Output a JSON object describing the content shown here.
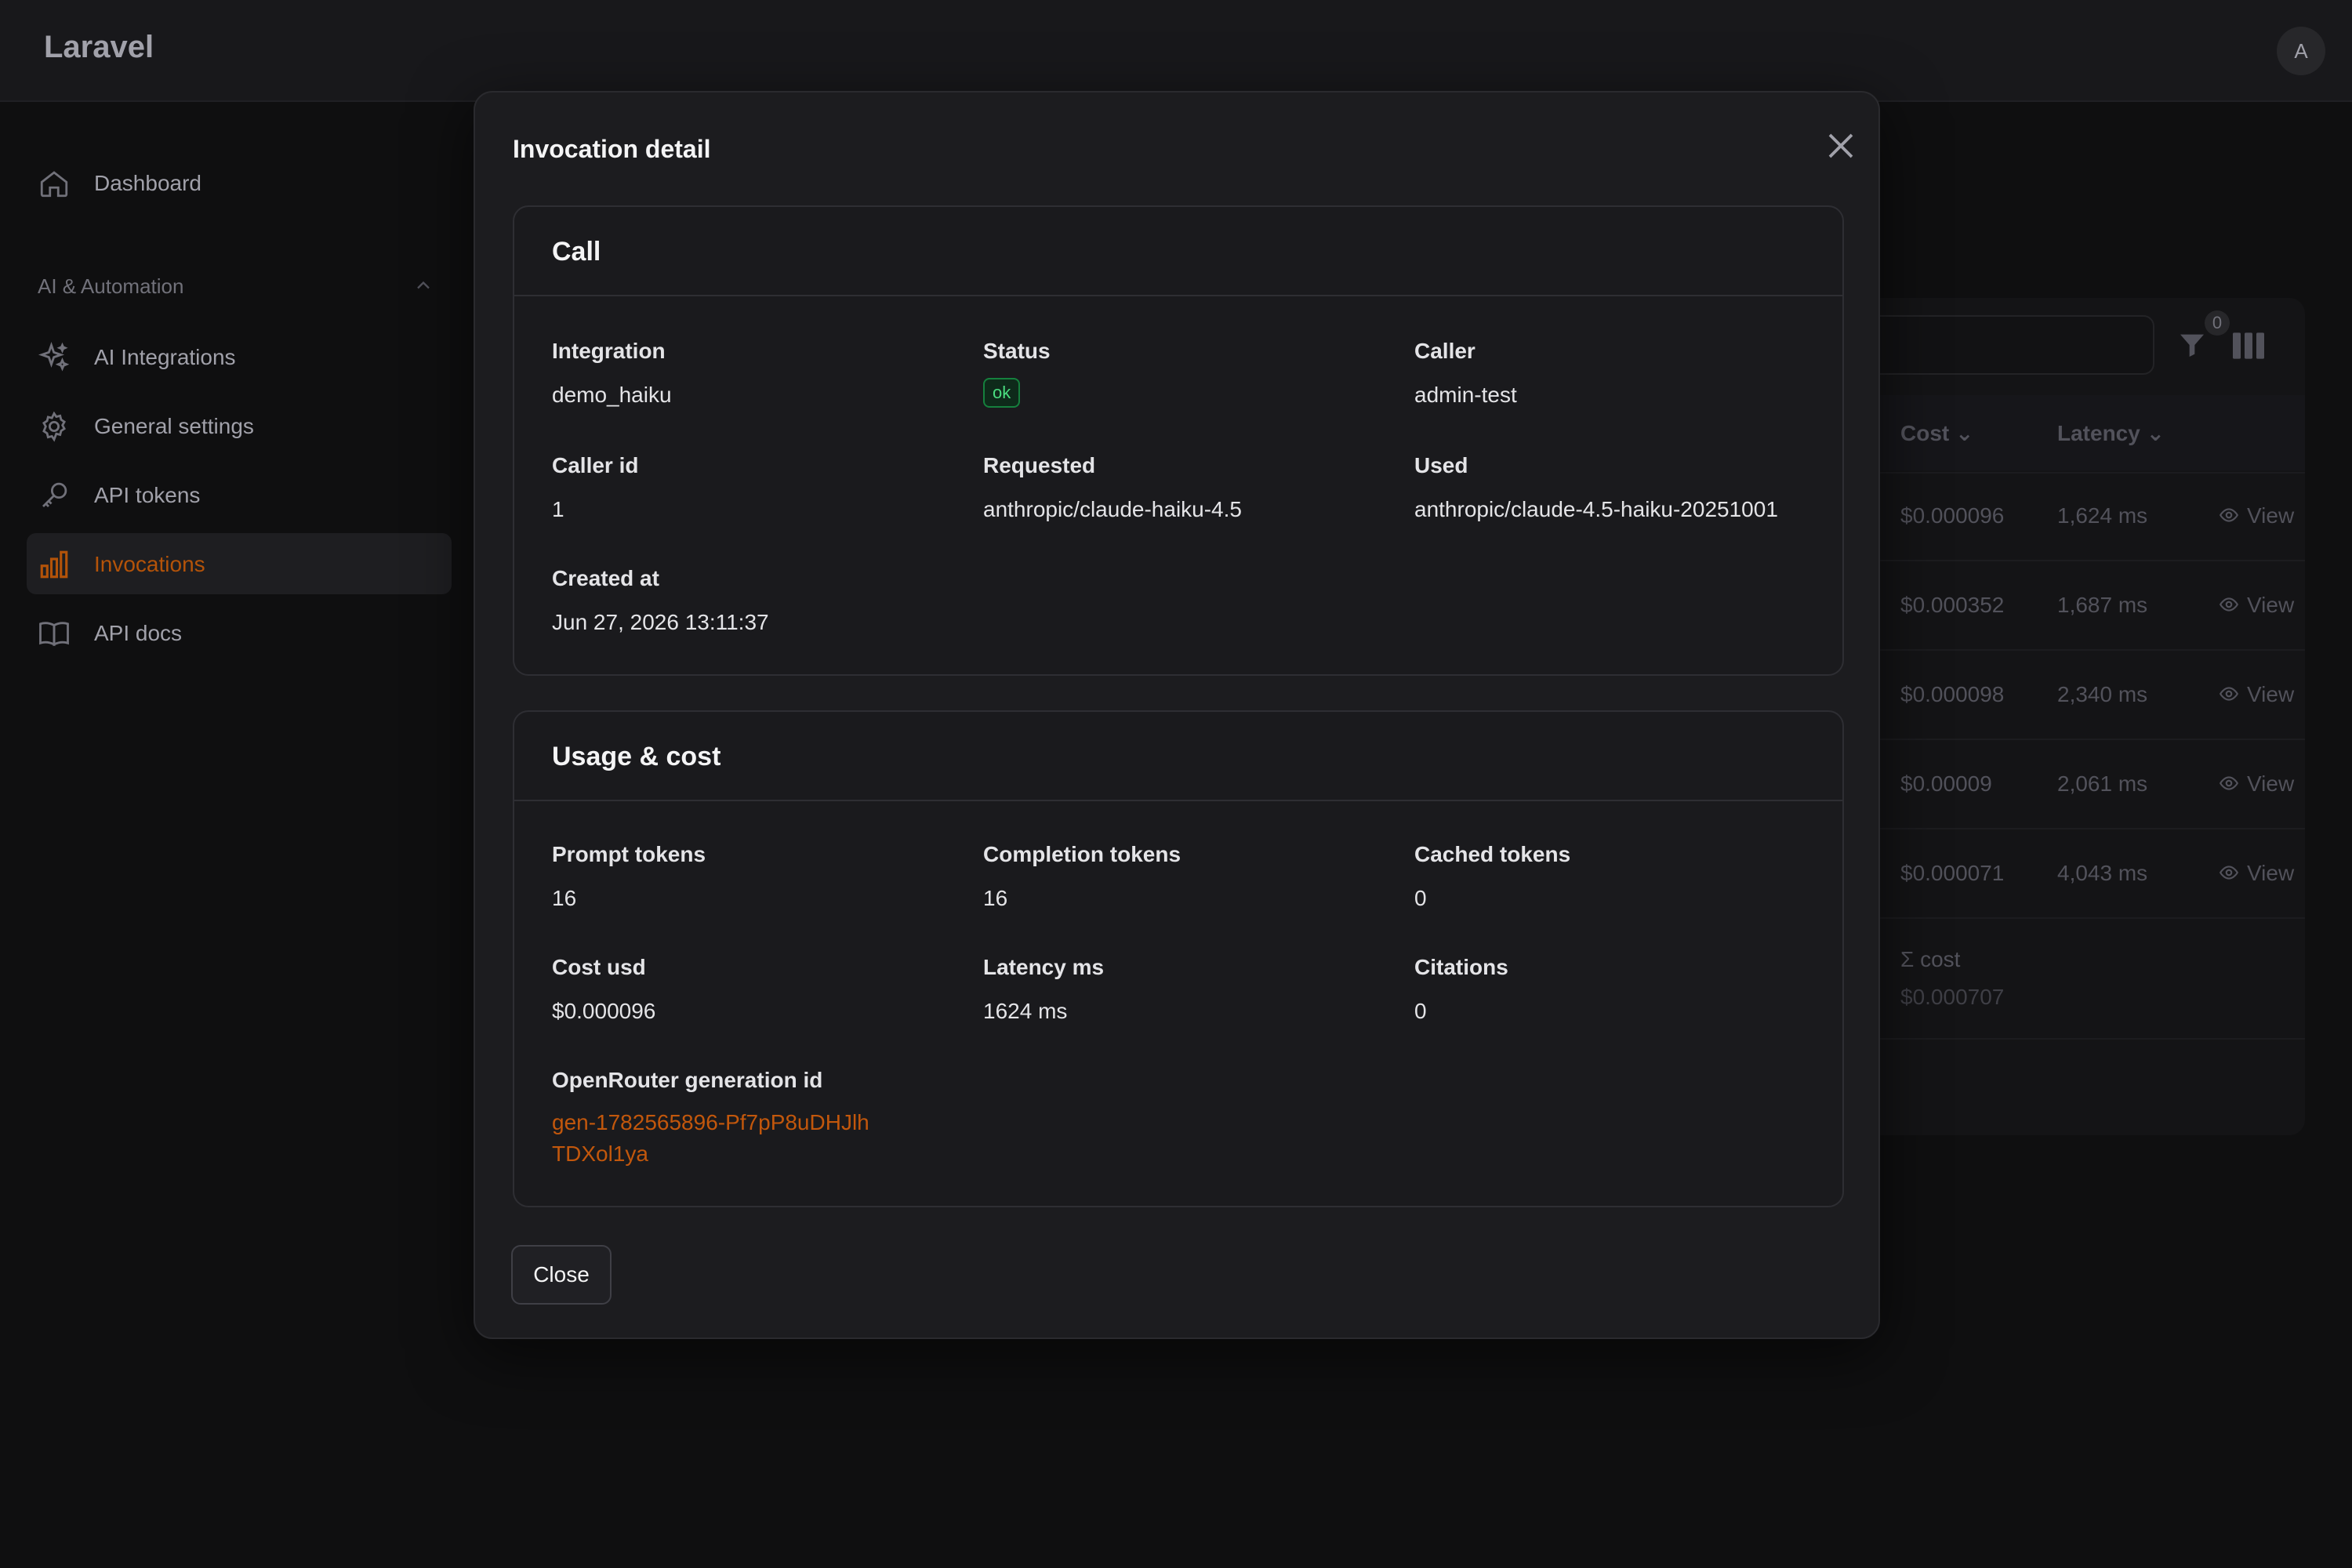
{
  "app": {
    "brand": "Laravel",
    "avatar_initial": "A"
  },
  "sidebar": {
    "items": [
      {
        "label": "Dashboard",
        "icon": "home-icon"
      },
      {
        "label": "AI Integrations",
        "icon": "sparkles-icon"
      },
      {
        "label": "General settings",
        "icon": "gear-icon"
      },
      {
        "label": "API tokens",
        "icon": "key-icon"
      },
      {
        "label": "Invocations",
        "icon": "bar-chart-icon",
        "active": true
      },
      {
        "label": "API docs",
        "icon": "book-icon"
      }
    ],
    "group_label": "AI & Automation"
  },
  "background_table": {
    "filter_count": "0",
    "columns": [
      "Cost",
      "Latency"
    ],
    "rows": [
      {
        "cost": "$0.000096",
        "latency": "1,624 ms",
        "action": "View"
      },
      {
        "cost": "$0.000352",
        "latency": "1,687 ms",
        "action": "View"
      },
      {
        "cost": "$0.000098",
        "latency": "2,340 ms",
        "action": "View"
      },
      {
        "cost": "$0.00009",
        "latency": "2,061 ms",
        "action": "View"
      },
      {
        "cost": "$0.000071",
        "latency": "4,043 ms",
        "action": "View"
      }
    ],
    "summary_label": "Σ cost",
    "summary_value": "$0.000707"
  },
  "modal": {
    "title": "Invocation detail",
    "close_label": "Close",
    "call": {
      "title": "Call",
      "fields": [
        {
          "label": "Integration",
          "value": "demo_haiku"
        },
        {
          "label": "Status",
          "value": "ok"
        },
        {
          "label": "Caller",
          "value": "admin-test"
        },
        {
          "label": "Caller id",
          "value": "1"
        },
        {
          "label": "Requested",
          "value": "anthropic/claude-haiku-4.5"
        },
        {
          "label": "Used",
          "value": "anthropic/claude-4.5-haiku-20251001"
        },
        {
          "label": "Created at",
          "value": "Jun 27, 2026 13:11:37"
        }
      ]
    },
    "usage": {
      "title": "Usage & cost",
      "fields": [
        {
          "label": "Prompt tokens",
          "value": "16"
        },
        {
          "label": "Completion tokens",
          "value": "16"
        },
        {
          "label": "Cached tokens",
          "value": "0"
        },
        {
          "label": "Cost usd",
          "value": "$0.000096"
        },
        {
          "label": "Latency ms",
          "value": "1624 ms"
        },
        {
          "label": "Citations",
          "value": "0"
        },
        {
          "label": "OpenRouter generation id",
          "value": "gen-1782565896-Pf7pP8uDHJlhTDXol1ya"
        }
      ]
    }
  },
  "colors": {
    "accent": "#c2570c",
    "status_ok": "#4ade80",
    "background": "#0f0f10",
    "modal": "#1c1c1f"
  }
}
